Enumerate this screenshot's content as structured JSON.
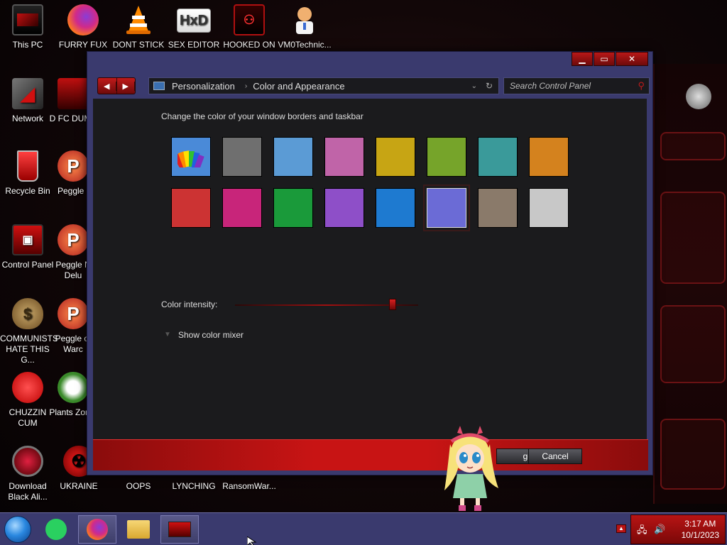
{
  "desktop_icons": [
    {
      "label": "This PC",
      "icon": "monitor-icon"
    },
    {
      "label": "FURRY FUX",
      "icon": "firefox-icon"
    },
    {
      "label": "DONT STICK",
      "icon": "vlc-cone-icon"
    },
    {
      "label": "SEX EDITOR",
      "icon": "hxd-icon"
    },
    {
      "label": "HOOKED ON",
      "icon": "alien-monitor-icon"
    },
    {
      "label": "VM0Technic...",
      "icon": "doctor-icon"
    },
    {
      "label": "Network",
      "icon": "network-icon"
    },
    {
      "label": "D FC DUMB",
      "icon": "app-icon"
    },
    {
      "label": "Recycle Bin",
      "icon": "recycle-bin-icon"
    },
    {
      "label": "Peggle I",
      "icon": "peggle-icon"
    },
    {
      "label": "Control Panel",
      "icon": "control-panel-icon"
    },
    {
      "label": "Peggle N Delu",
      "icon": "peggle-icon"
    },
    {
      "label": "COMMUNISTS HATE THIS G...",
      "icon": "money-bag-icon"
    },
    {
      "label": "Peggle of Warc",
      "icon": "peggle-icon"
    },
    {
      "label": "CHUZZIN CUM",
      "icon": "chuzzle-icon"
    },
    {
      "label": "Plants Zomb",
      "icon": "plants-icon"
    },
    {
      "label": "Download Black Ali...",
      "icon": "alien-skin-icon"
    },
    {
      "label": "UKRAINE",
      "icon": "radiation-icon"
    },
    {
      "label": "OOPS",
      "icon": "blank-icon"
    },
    {
      "label": "LYNCHING",
      "icon": "blank-icon"
    },
    {
      "label": "RansomWar...",
      "icon": "blank-icon"
    }
  ],
  "window": {
    "breadcrumb": [
      "Personalization",
      "Color and Appearance"
    ],
    "search_placeholder": "Search Control Panel",
    "heading": "Change the color of your window borders and taskbar",
    "swatches_row1": [
      "rainbow",
      "#6f6f6f",
      "#5b9bd5",
      "#c064a8",
      "#c7a514",
      "#76a42a",
      "#3a9a9a",
      "#d4821e"
    ],
    "swatches_row2": [
      "#cc3333",
      "#c8257a",
      "#1a9a3a",
      "#8e4fc8",
      "#1e7ad0",
      "#6b6bd6",
      "#8a7a6a",
      "#c8c8c8"
    ],
    "selected_swatch": "#6b6bd6",
    "intensity_label": "Color intensity:",
    "intensity_value": 0.86,
    "mixer_label": "Show color mixer",
    "save_label": "ges",
    "cancel_label": "Cancel"
  },
  "taskbar": {
    "time": "3:17 AM",
    "date": "10/1/2023"
  },
  "colors": {
    "accent": "#c81414",
    "window_frame": "#3a3a6e",
    "content_bg": "#1b1b1d"
  }
}
